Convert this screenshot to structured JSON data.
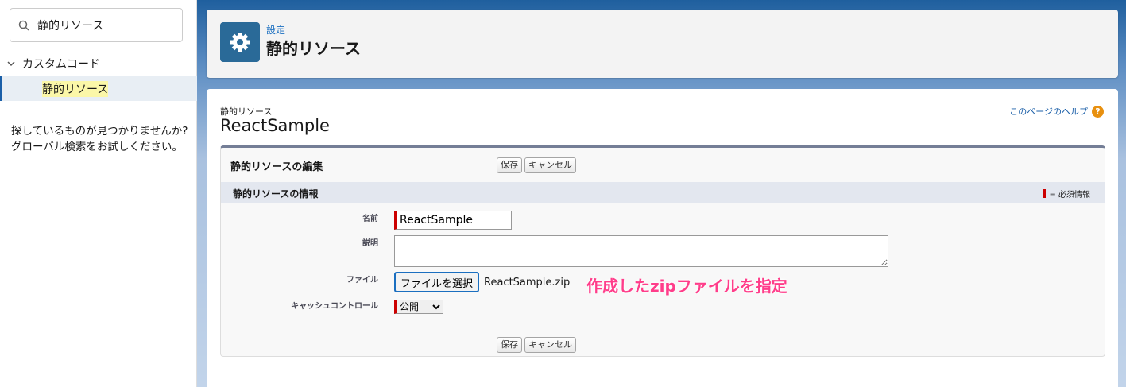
{
  "sidebar": {
    "search_value": "静的リソース",
    "parent": "カスタムコード",
    "child": "静的リソース",
    "notfound_1": "探しているものが見つかりませんか?",
    "notfound_2": "グローバル検索をお試しください。"
  },
  "header": {
    "breadcrumb": "設定",
    "title": "静的リソース"
  },
  "record": {
    "type": "静的リソース",
    "name": "ReactSample",
    "help": "このページのヘルプ",
    "help_icon": "?"
  },
  "edit": {
    "title": "静的リソースの編集",
    "save": "保存",
    "cancel": "キャンセル",
    "section": "静的リソースの情報",
    "required": "= 必須情報"
  },
  "form": {
    "name_label": "名前",
    "name_value": "ReactSample",
    "desc_label": "説明",
    "desc_value": "",
    "file_label": "ファイル",
    "file_button": "ファイルを選択",
    "file_name": "ReactSample.zip",
    "cache_label": "キャッシュコントロール",
    "cache_value": "公開"
  },
  "annotation": "作成したzipファイルを指定"
}
